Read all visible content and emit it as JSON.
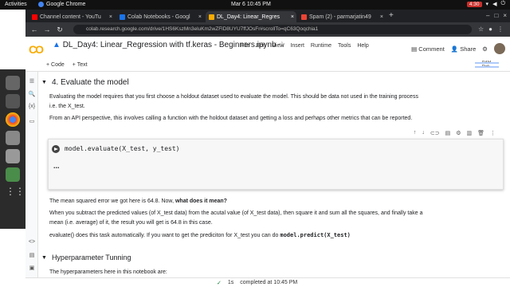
{
  "system": {
    "activities": "Activities",
    "app_name": "Google Chrome",
    "clock": "Mar 6  10:45 PM",
    "battery": "4:30"
  },
  "browser": {
    "tabs": [
      {
        "label": "Channel content - YouTu",
        "icon_color": "#ff0000"
      },
      {
        "label": "Colab Notebooks - Googl",
        "icon_color": "#1a73e8"
      },
      {
        "label": "DL_Day4: Linear_Regres",
        "icon_color": "#f9ab00"
      },
      {
        "label": "Spam (2) - parmarjatin49",
        "icon_color": "#ea4335"
      }
    ],
    "url": "colab.research.google.com/drive/1HS6KszMn3eluKm2wZFlD8UYU7ffJOsFr#scrollTo=qC63Qoqchia1"
  },
  "colab": {
    "logo": "CO",
    "title": "DL_Day4: Linear_Regression with tf.keras - Beginners.ipynb",
    "menu": [
      "File",
      "Edit",
      "View",
      "Insert",
      "Runtime",
      "Tools",
      "Help"
    ],
    "comment": "Comment",
    "share": "Share",
    "add_code": "+ Code",
    "add_text": "+ Text",
    "ram": "RAM",
    "disk": "Disk"
  },
  "notebook": {
    "section_title": "4. Evaluate the model",
    "p1": "Evaluating the model requires that you first choose a holdout dataset used to evaluate the model. This should be data not used in the training process i.e. the X_test.",
    "p2": "From an API perspective, this involves calling a function with the holdout dataset and getting a loss and perhaps other metrics that can be reported.",
    "code": "model.evaluate(X_test, y_test)",
    "output": "...",
    "p3_pre": "The mean squared error we got here is 64.8. Now, ",
    "p3_bold": "what does it mean?",
    "p4": "When you subtract the predicted values (of X_test data) from the acutal value (of X_test data), then square it and sum all the squares, and finally take a mean (i.e. average) of it, the result you will get is 64.8 in this case.",
    "p5_pre": "evaluate() does this task automatically. If you want to get the prediciton for X_test you can do ",
    "p5_code": "model.predict(X_test)",
    "section2_title": "Hyperparameter Tunning",
    "p6": "The hyperparameters here in this notebook are:"
  },
  "status": {
    "check": "✓",
    "duration": "1s",
    "completed": "completed at 10:45 PM"
  }
}
